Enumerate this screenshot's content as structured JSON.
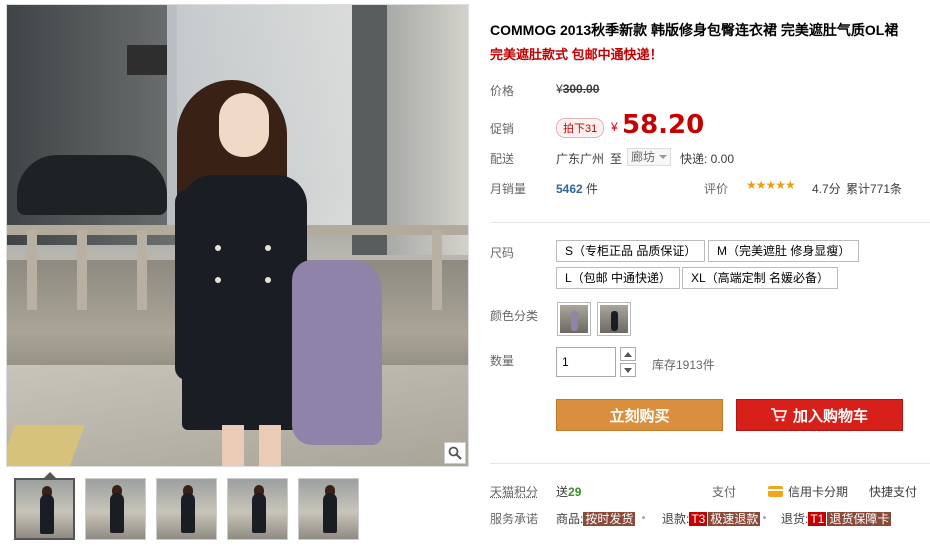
{
  "product": {
    "title": "COMMOG 2013秋季新款 韩版修身包臀连衣裙 完美遮肚气质OL裙",
    "subtitle": "完美遮肚款式 包邮中通快递！"
  },
  "price": {
    "label": "价格",
    "currency": "¥",
    "original": "300.00",
    "promo_label": "促销",
    "discount_tag": "拍下31",
    "current": "58.20"
  },
  "shipping": {
    "label": "配送",
    "from": "广东广州",
    "to_word": "至",
    "city": "廊坊",
    "fee": "快递: 0.00"
  },
  "sales": {
    "label": "月销量",
    "count": "5462",
    "unit": "件",
    "rating_label": "评价",
    "stars": "★★★★★",
    "stars_value": 4.7,
    "score": "4.7分",
    "reviews": "累计771条"
  },
  "size": {
    "label": "尺码",
    "options": [
      "S（专柜正品 品质保证）",
      "M（完美遮肚 修身显瘦）",
      "L（包邮 中通快递）",
      "XL（高端定制 名媛必备）"
    ]
  },
  "color": {
    "label": "颜色分类"
  },
  "quantity": {
    "label": "数量",
    "value": "1",
    "stock": "库存1913件"
  },
  "actions": {
    "buy": "立刻购买",
    "cart": "加入购物车"
  },
  "points": {
    "label": "天猫积分",
    "give_word": "送",
    "amount": "29",
    "pay_label": "支付",
    "credit": "信用卡分期",
    "quickpay": "快捷支付"
  },
  "service": {
    "label": "服务承诺",
    "goods_word": "商品:",
    "goods_tag": "按时发货",
    "refund_word": "退款:",
    "refund_code": "T3",
    "refund_tag": "极速退款",
    "return_word": "退货:",
    "return_code": "T1",
    "return_tag": "退货保障卡"
  },
  "colors": {
    "accent": "#c40000",
    "buy_button": "#d98f3e",
    "cart_button": "#d7201a"
  }
}
